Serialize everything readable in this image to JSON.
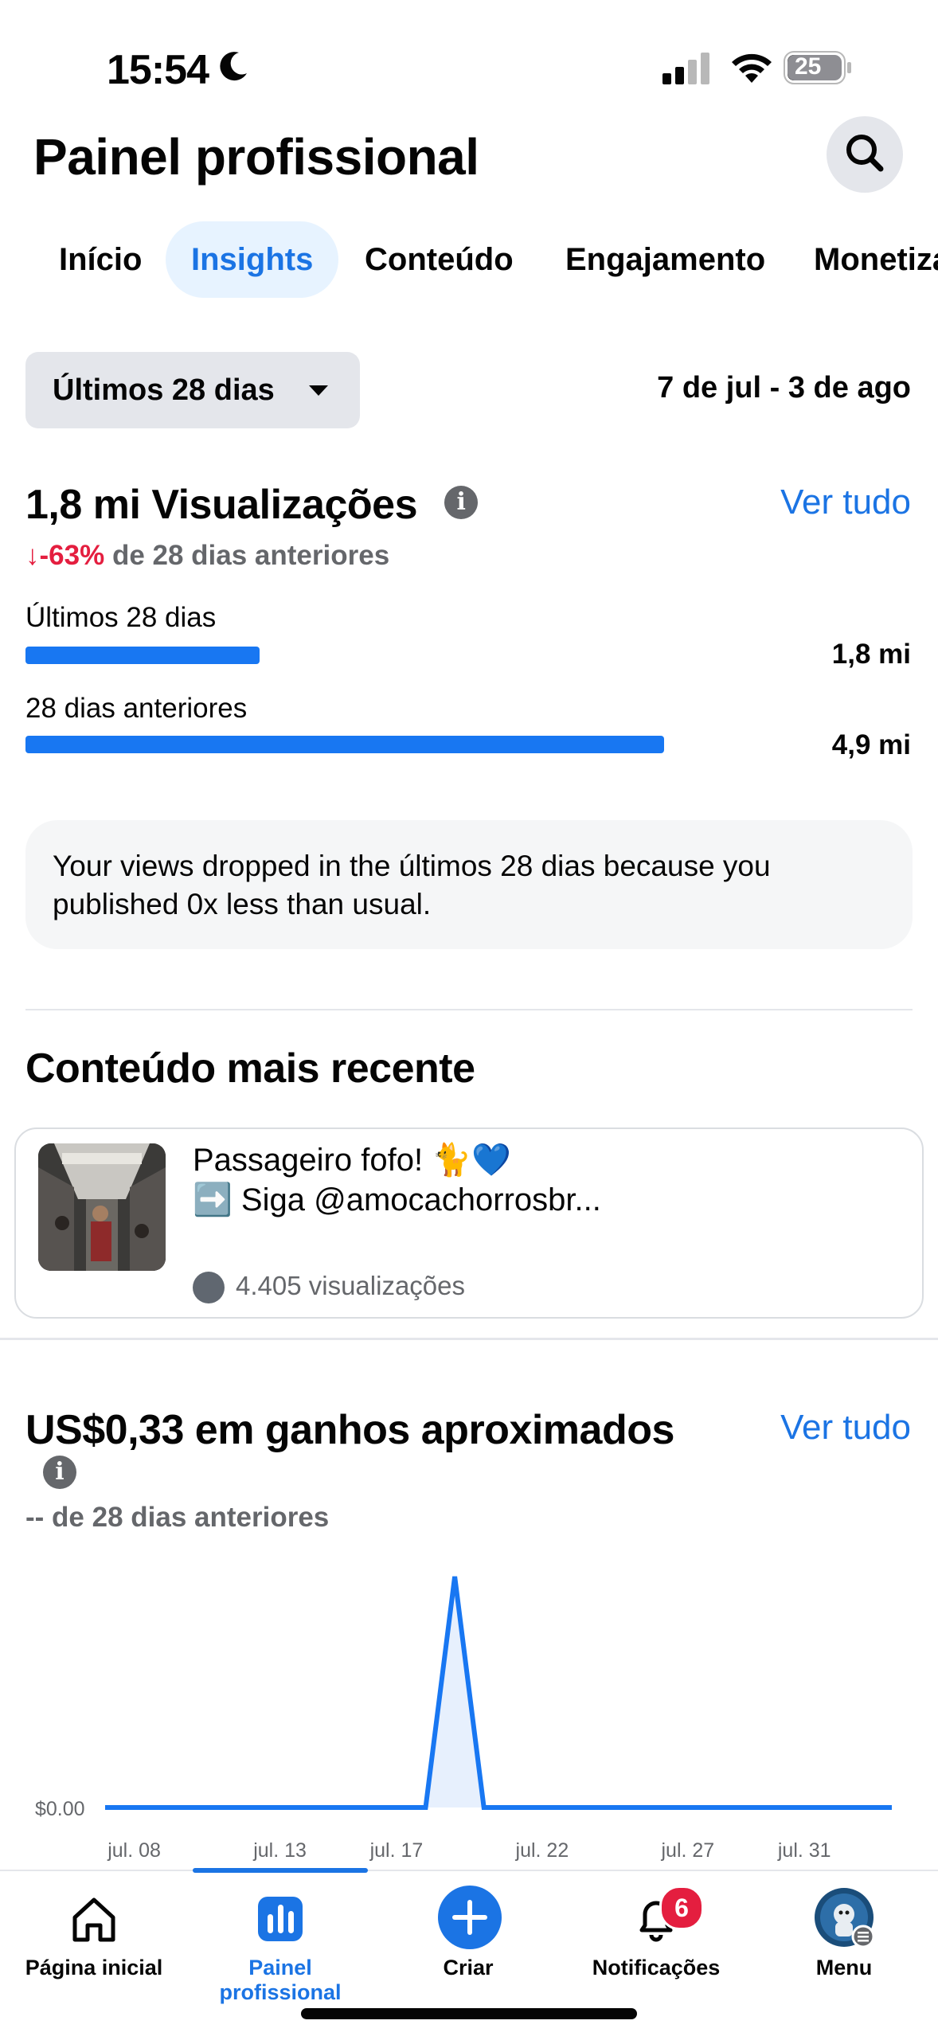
{
  "status_bar": {
    "time": "15:54",
    "battery": "25"
  },
  "header": {
    "title": "Painel profissional"
  },
  "tabs": [
    {
      "label": "Início"
    },
    {
      "label": "Insights"
    },
    {
      "label": "Conteúdo"
    },
    {
      "label": "Engajamento"
    },
    {
      "label": "Monetização"
    }
  ],
  "period": {
    "selector_label": "Últimos 28 dias",
    "date_range": "7 de jul - 3 de ago"
  },
  "views": {
    "title": "1,8 mi Visualizações",
    "see_all": "Ver tudo",
    "change": "-63%",
    "change_suffix": "de 28 dias anteriores",
    "current_label": "Últimos 28 dias",
    "current_value": "1,8 mi",
    "current_fraction": 0.367,
    "previous_label": "28 dias anteriores",
    "previous_value": "4,9 mi",
    "previous_fraction": 1.0,
    "note": "Your views dropped in the últimos 28 dias because you published 0x less than usual."
  },
  "recent_content": {
    "title": "Conteúdo mais recente",
    "post_line1": "Passageiro fofo! 🐈💙",
    "post_line2": "➡️ Siga @amocachorrosbr...",
    "views": "4.405 visualizações"
  },
  "earnings": {
    "title": "US$0,33 em ganhos aproximados",
    "see_all": "Ver tudo",
    "comparison": "-- de 28 dias anteriores"
  },
  "chart_data": {
    "type": "area",
    "y_tick": "$0.00",
    "x_ticks": [
      "jul. 08",
      "jul. 13",
      "jul. 17",
      "jul. 22",
      "jul. 27",
      "jul. 31"
    ],
    "x": [
      "jul. 07",
      "jul. 08",
      "jul. 09",
      "jul. 10",
      "jul. 11",
      "jul. 12",
      "jul. 13",
      "jul. 14",
      "jul. 15",
      "jul. 16",
      "jul. 17",
      "jul. 18",
      "jul. 19",
      "jul. 20",
      "jul. 21",
      "jul. 22",
      "jul. 23",
      "jul. 24",
      "jul. 25",
      "jul. 26",
      "jul. 27",
      "jul. 28",
      "jul. 29",
      "jul. 30",
      "jul. 31",
      "ago. 01",
      "ago. 02",
      "ago. 03"
    ],
    "values": [
      0,
      0,
      0,
      0,
      0,
      0,
      0,
      0,
      0,
      0,
      0,
      0,
      0.33,
      0,
      0,
      0,
      0,
      0,
      0,
      0,
      0,
      0,
      0,
      0,
      0,
      0,
      0,
      0
    ],
    "color": "#1877f2"
  },
  "bottom_nav": [
    {
      "label": "Página inicial",
      "icon": "home-icon"
    },
    {
      "label": "Painel profissional",
      "icon": "dashboard-icon"
    },
    {
      "label": "Criar",
      "icon": "plus-icon"
    },
    {
      "label": "Notificações",
      "icon": "bell-icon",
      "badge": "6"
    },
    {
      "label": "Menu",
      "icon": "profile-avatar"
    }
  ],
  "colors": {
    "accent": "#1b74e4",
    "negative": "#e41e3f",
    "muted": "#65676b"
  }
}
